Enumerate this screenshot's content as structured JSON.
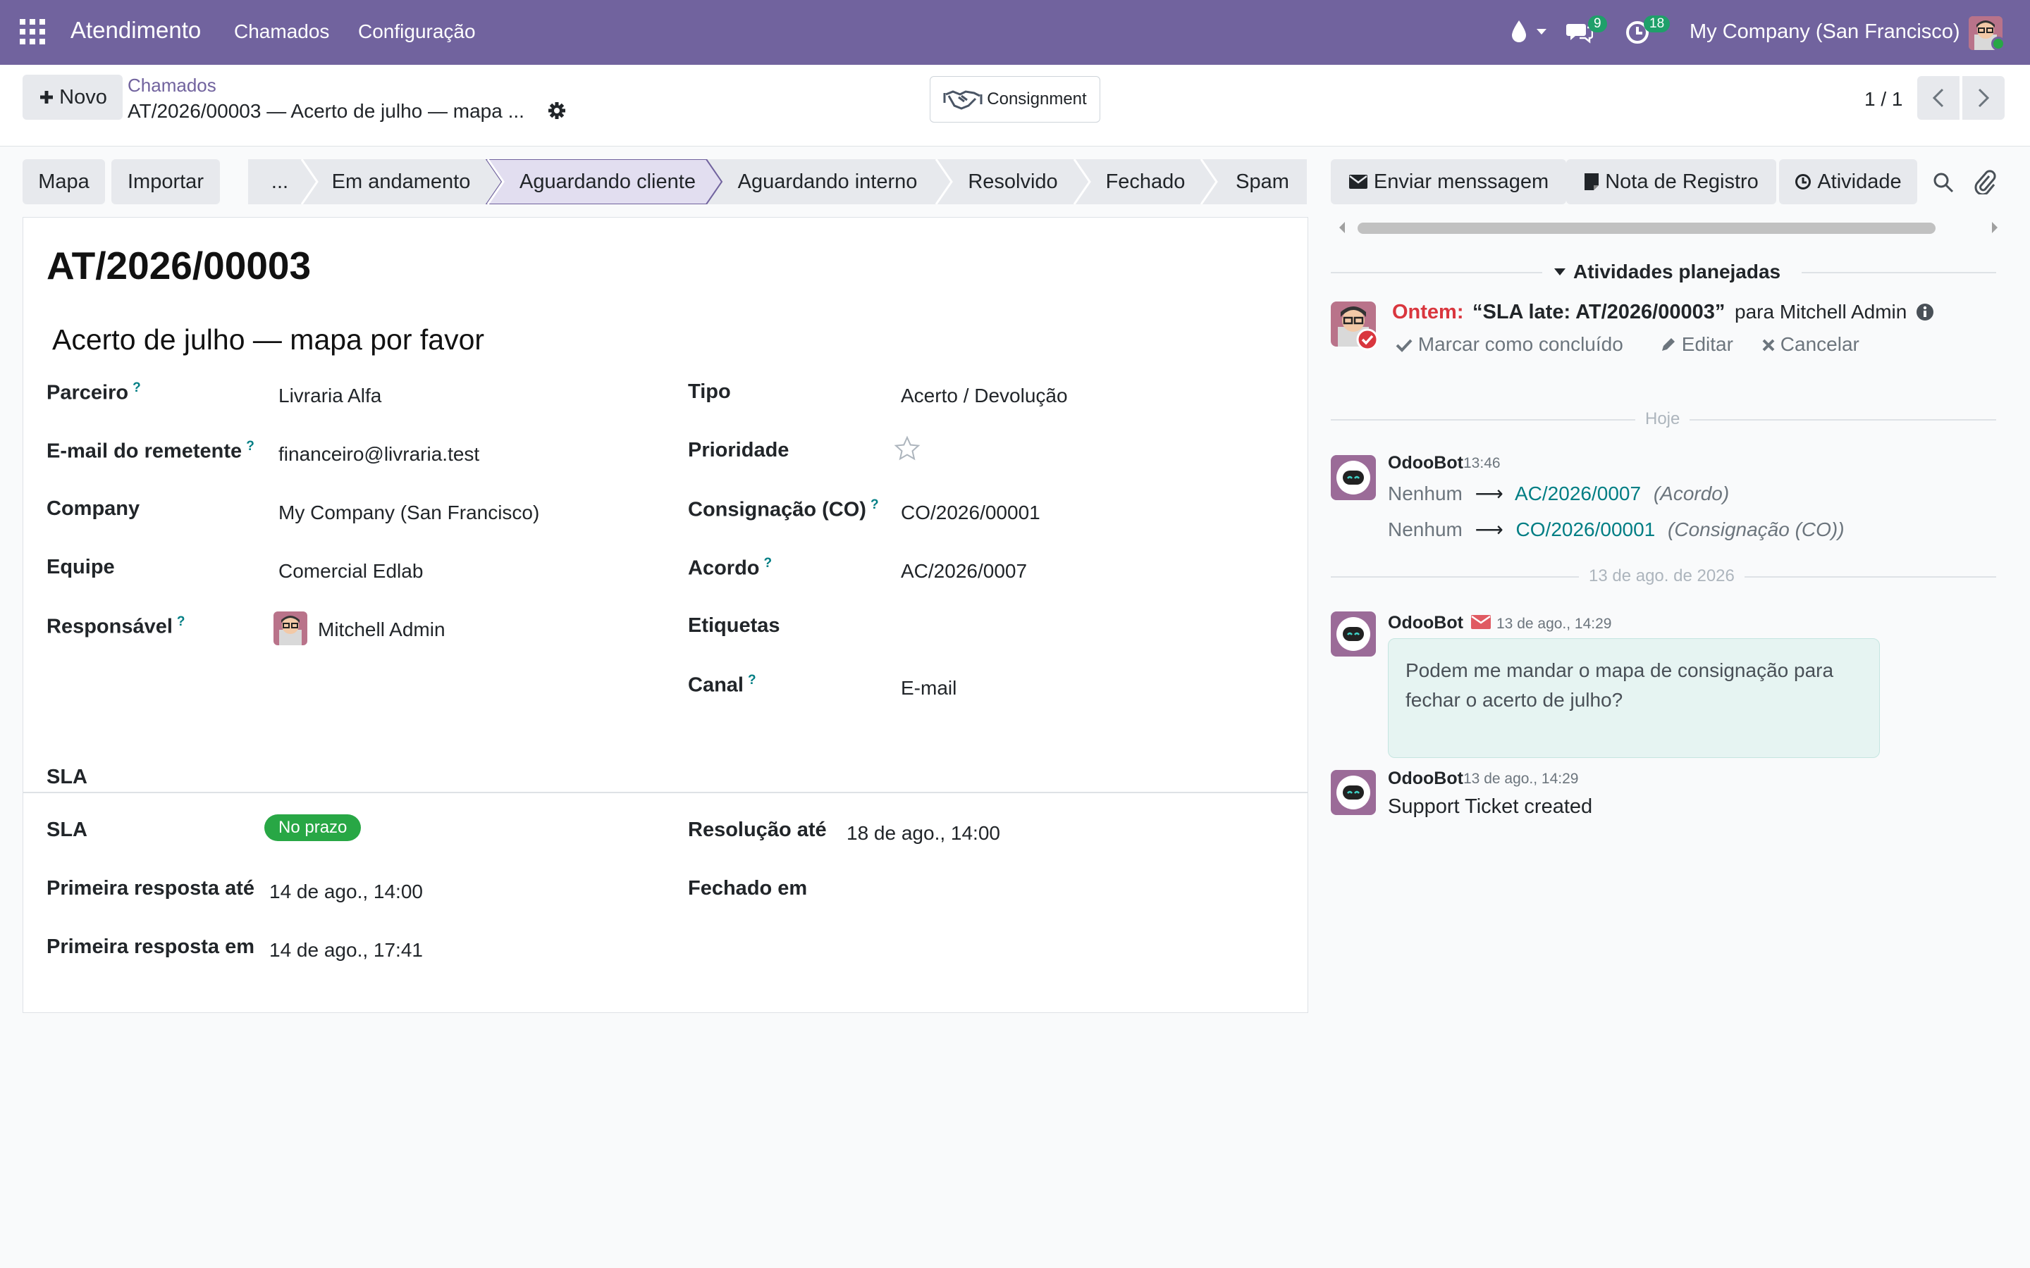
{
  "navbar": {
    "app_name": "Atendimento",
    "menu": [
      "Chamados",
      "Configuração"
    ],
    "messages_count": "9",
    "activities_count": "18",
    "company": "My Company (San Francisco)"
  },
  "control_panel": {
    "new_button": "Novo",
    "breadcrumb_parent": "Chamados",
    "breadcrumb_current": "AT/2026/00003 — Acerto de julho — mapa ...",
    "consignment_button": "Consignment",
    "pager": "1 / 1"
  },
  "statusbar": {
    "actions": [
      "Mapa",
      "Importar"
    ],
    "stages": [
      "...",
      "Em andamento",
      "Aguardando cliente",
      "Aguardando interno",
      "Resolvido",
      "Fechado",
      "Spam"
    ],
    "active_stage": "Aguardando cliente"
  },
  "ticket": {
    "reference": "AT/2026/00003",
    "subject": "Acerto de julho — mapa por favor",
    "fields_left": [
      {
        "label": "Parceiro",
        "help": "?",
        "value": "Livraria Alfa"
      },
      {
        "label": "E-mail do remetente",
        "help": "?",
        "value": "financeiro@livraria.test"
      },
      {
        "label": "Company",
        "help": "",
        "value": "My Company (San Francisco)"
      },
      {
        "label": "Equipe",
        "help": "",
        "value": "Comercial Edlab"
      },
      {
        "label": "Responsável",
        "help": "?",
        "value": "Mitchell Admin"
      }
    ],
    "fields_right": [
      {
        "label": "Tipo",
        "help": "",
        "value": "Acerto / Devolução"
      },
      {
        "label": "Prioridade",
        "help": "",
        "value": ""
      },
      {
        "label": "Consignação (CO)",
        "help": "?",
        "value": "CO/2026/00001"
      },
      {
        "label": "Acordo",
        "help": "?",
        "value": "AC/2026/0007"
      },
      {
        "label": "Etiquetas",
        "help": "",
        "value": ""
      },
      {
        "label": "Canal",
        "help": "?",
        "value": "E-mail"
      }
    ],
    "priority_stars": 0,
    "sla_section_title": "SLA",
    "sla": {
      "sla_label": "SLA",
      "sla_status": "No prazo",
      "first_response_due_label": "Primeira resposta até",
      "first_response_due": "14 de ago., 14:00",
      "first_response_at_label": "Primeira resposta em",
      "first_response_at": "14 de ago., 17:41",
      "resolution_due_label": "Resolução até",
      "resolution_due": "18 de ago., 14:00",
      "closed_at_label": "Fechado em",
      "closed_at": ""
    }
  },
  "chatter": {
    "buttons": [
      "Enviar menssagem",
      "Nota de Registro",
      "Atividade"
    ],
    "planned_title": "Atividades planejadas",
    "activity": {
      "when": "Ontem:",
      "summary": "“SLA late: AT/2026/00003”",
      "assignee": "para Mitchell Admin",
      "actions": [
        "Marcar como concluído",
        "Editar",
        "Cancelar"
      ]
    },
    "separators": [
      "Hoje",
      "13 de ago. de 2026"
    ],
    "messages": [
      {
        "author": "OdooBot",
        "time": "13:46",
        "tracking": [
          {
            "old": "Nenhum",
            "new": "AC/2026/0007",
            "field": "(Acordo)"
          },
          {
            "old": "Nenhum",
            "new": "CO/2026/00001",
            "field": "(Consignação (CO))"
          }
        ]
      },
      {
        "author": "OdooBot",
        "time": "13 de ago., 14:29",
        "body_line1": "Podem me mandar o mapa de consignação para",
        "body_line2": "fechar o acerto de julho?"
      },
      {
        "author": "OdooBot",
        "time": "13 de ago., 14:29",
        "body": "Support Ticket created"
      }
    ]
  },
  "colors": {
    "navbar": "#71639e",
    "link": "#017e84",
    "overdue": "#d9363e",
    "sla_ok": "#28a745"
  }
}
